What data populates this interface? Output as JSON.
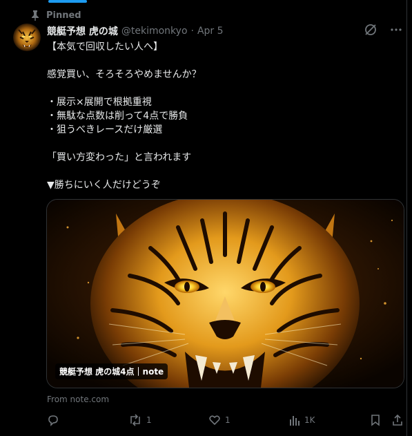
{
  "pinned": {
    "label": "Pinned"
  },
  "tweet": {
    "display_name": "競艇予想 虎の城",
    "handle": "@tekimonkyo",
    "separator": "·",
    "date": "Apr 5",
    "text": "【本気で回収したい人へ】\n\n感覚買い、そろそろやめませんか？\n\n・展示×展開で根拠重視\n・無駄な点数は削って4点で勝負\n・狙うべきレースだけ厳選\n\n「買い方変わった」と言われます\n\n▼勝ちにいく人だけどうぞ"
  },
  "card": {
    "label": "競艇予想 虎の城4点｜note",
    "from": "From note.com"
  },
  "actions": {
    "replies": "",
    "reposts": "1",
    "likes": "1",
    "views": "1K"
  },
  "colors": {
    "accent": "#1d9bf0",
    "muted": "#71767b",
    "text": "#e7e9ea",
    "background": "#000000"
  }
}
